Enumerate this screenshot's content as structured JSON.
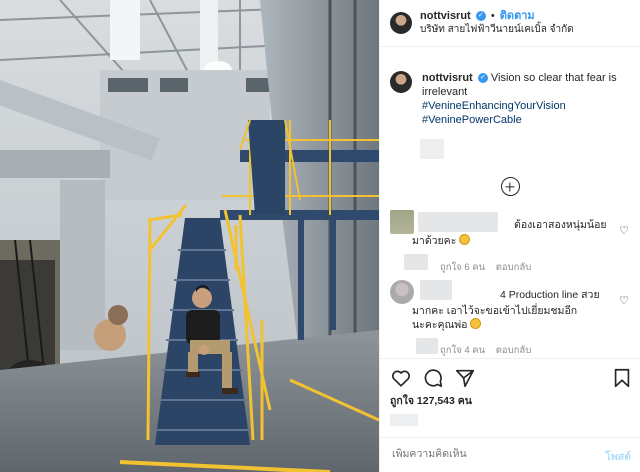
{
  "header": {
    "username": "nottvisrut",
    "separator": "•",
    "follow_label": "ติดตาม",
    "location": "บริษัท สายไฟฟ้าวีนายน์เคเบิ้ล จำกัด",
    "more": "•••"
  },
  "caption": {
    "username": "nottvisrut",
    "text": "Vision so clear that fear is irrelevant",
    "hashtags": [
      "#VenineEnhancingYourVision",
      "#VeninePowerCable"
    ]
  },
  "comments": [
    {
      "text_line1": "ต้องเอาสองหนุ่มน้อย",
      "text_line2": "มาด้วยคะ",
      "likes": "ถูกใจ 6 คน",
      "reply": "ตอบกลับ"
    },
    {
      "text_line1": "4 Production line สวย",
      "text_line2": "มากคะ เอาไว้จะขอเข้าไปเยี่ยมชมอีก",
      "text_line3": "นะคะคุณพ่อ",
      "likes": "ถูกใจ 4 คน",
      "reply": "ตอบกลับ"
    }
  ],
  "likes_count": "ถูกใจ 127,543 คน",
  "add_comment_placeholder": "เพิ่มความคิดเห็น",
  "post_label": "โพสต์",
  "colors": {
    "link": "#3897f0",
    "hashtag": "#00376b",
    "post_disabled": "#b2dffc",
    "stair_yellow": "#f2c230",
    "steel_blue": "#2f4a6d"
  }
}
